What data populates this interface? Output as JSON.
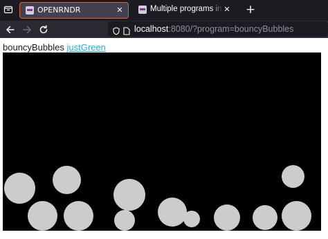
{
  "browser": {
    "tabs": [
      {
        "title": "OPENRNDR",
        "active": true
      },
      {
        "title": "Multiple programs in one",
        "active": false
      }
    ],
    "url": {
      "host": "localhost",
      "rest": ":8080/?program=bouncyBubbles"
    }
  },
  "page": {
    "program_name": "bouncyBubbles",
    "link_label": "justGreen"
  },
  "canvas": {
    "background": "#000000",
    "bubble_color": "#cccccc"
  },
  "colors": {
    "tab_bar": "#1c1b22",
    "nav_bar": "#2b2a33",
    "active_tab_border": "#e0613a",
    "link": "#1fb4d6"
  }
}
